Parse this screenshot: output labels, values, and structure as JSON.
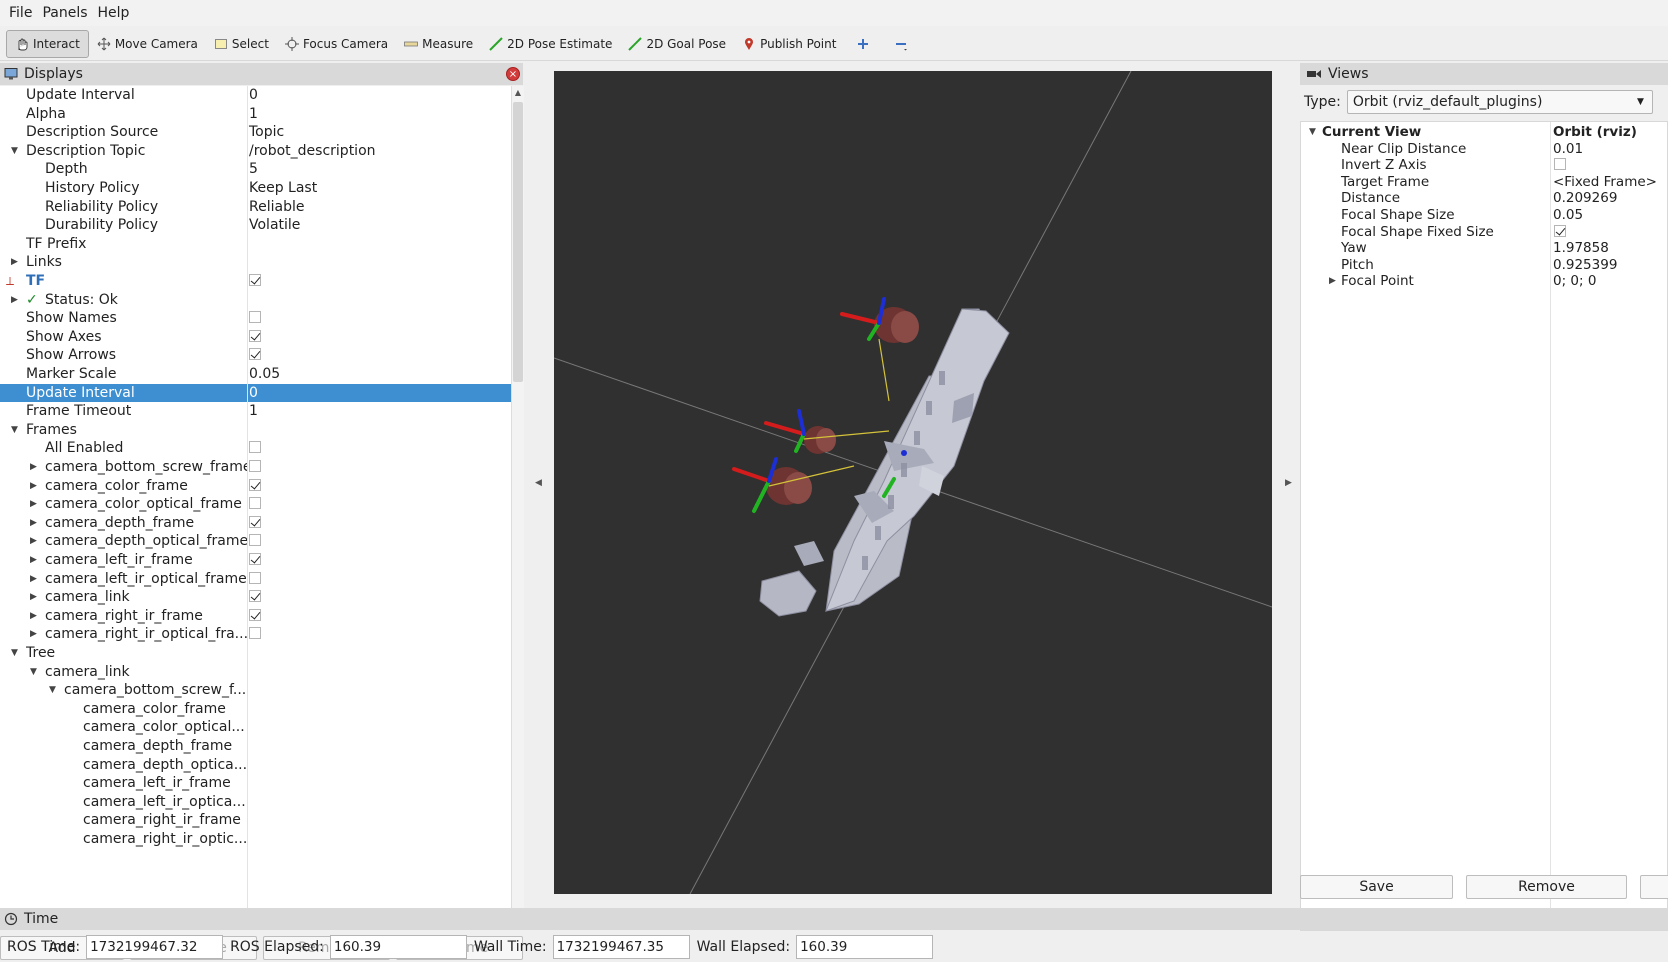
{
  "menu": [
    "File",
    "Panels",
    "Help"
  ],
  "toolbar": [
    {
      "label": "Interact",
      "icon": "interact-icon",
      "active": true
    },
    {
      "label": "Move Camera",
      "icon": "move-camera-icon"
    },
    {
      "label": "Select",
      "icon": "select-icon"
    },
    {
      "label": "Focus Camera",
      "icon": "focus-camera-icon"
    },
    {
      "label": "Measure",
      "icon": "measure-icon"
    },
    {
      "label": "2D Pose Estimate",
      "icon": "pose-estimate-icon"
    },
    {
      "label": "2D Goal Pose",
      "icon": "goal-pose-icon"
    },
    {
      "label": "Publish Point",
      "icon": "publish-point-icon"
    }
  ],
  "displays": {
    "title": "Displays",
    "rows": [
      {
        "name": "Update Interval",
        "value": "0",
        "indent": 0
      },
      {
        "name": "Alpha",
        "value": "1",
        "indent": 0
      },
      {
        "name": "Description Source",
        "value": "Topic",
        "indent": 0
      },
      {
        "name": "Description Topic",
        "value": "/robot_description",
        "indent": 0,
        "arrow": "down"
      },
      {
        "name": "Depth",
        "value": "5",
        "indent": 1
      },
      {
        "name": "History Policy",
        "value": "Keep Last",
        "indent": 1
      },
      {
        "name": "Reliability Policy",
        "value": "Reliable",
        "indent": 1
      },
      {
        "name": "Durability Policy",
        "value": "Volatile",
        "indent": 1
      },
      {
        "name": "TF Prefix",
        "value": "",
        "indent": 0
      },
      {
        "name": "Links",
        "value": "",
        "indent": 0,
        "arrow": "right"
      },
      {
        "name": "TF",
        "value": "",
        "indent": 0,
        "check": true,
        "tf": true
      },
      {
        "name": "Status: Ok",
        "value": "",
        "indent": 0,
        "arrow": "right",
        "status": true
      },
      {
        "name": "Show Names",
        "value": "",
        "indent": 0,
        "check": false
      },
      {
        "name": "Show Axes",
        "value": "",
        "indent": 0,
        "check": true
      },
      {
        "name": "Show Arrows",
        "value": "",
        "indent": 0,
        "check": true
      },
      {
        "name": "Marker Scale",
        "value": "0.05",
        "indent": 0
      },
      {
        "name": "Update Interval",
        "value": "0",
        "indent": 0,
        "selected": true
      },
      {
        "name": "Frame Timeout",
        "value": "1",
        "indent": 0
      },
      {
        "name": "Frames",
        "value": "",
        "indent": 0,
        "arrow": "down"
      },
      {
        "name": "All Enabled",
        "value": "",
        "indent": 1,
        "check": false
      },
      {
        "name": "camera_bottom_screw_frame",
        "value": "",
        "indent": 1,
        "arrow": "right",
        "check": false
      },
      {
        "name": "camera_color_frame",
        "value": "",
        "indent": 1,
        "arrow": "right",
        "check": true
      },
      {
        "name": "camera_color_optical_frame",
        "value": "",
        "indent": 1,
        "arrow": "right",
        "check": false
      },
      {
        "name": "camera_depth_frame",
        "value": "",
        "indent": 1,
        "arrow": "right",
        "check": true
      },
      {
        "name": "camera_depth_optical_frame",
        "value": "",
        "indent": 1,
        "arrow": "right",
        "check": false
      },
      {
        "name": "camera_left_ir_frame",
        "value": "",
        "indent": 1,
        "arrow": "right",
        "check": true
      },
      {
        "name": "camera_left_ir_optical_frame",
        "value": "",
        "indent": 1,
        "arrow": "right",
        "check": false
      },
      {
        "name": "camera_link",
        "value": "",
        "indent": 1,
        "arrow": "right",
        "check": true
      },
      {
        "name": "camera_right_ir_frame",
        "value": "",
        "indent": 1,
        "arrow": "right",
        "check": true
      },
      {
        "name": "camera_right_ir_optical_fra...",
        "value": "",
        "indent": 1,
        "arrow": "right",
        "check": false
      },
      {
        "name": "Tree",
        "value": "",
        "indent": 0,
        "arrow": "down"
      },
      {
        "name": "camera_link",
        "value": "",
        "indent": 1,
        "arrow": "down"
      },
      {
        "name": "camera_bottom_screw_f...",
        "value": "",
        "indent": 2,
        "arrow": "down"
      },
      {
        "name": "camera_color_frame",
        "value": "",
        "indent": 3
      },
      {
        "name": "camera_color_optical...",
        "value": "",
        "indent": 3
      },
      {
        "name": "camera_depth_frame",
        "value": "",
        "indent": 3
      },
      {
        "name": "camera_depth_optica...",
        "value": "",
        "indent": 3
      },
      {
        "name": "camera_left_ir_frame",
        "value": "",
        "indent": 3
      },
      {
        "name": "camera_left_ir_optica...",
        "value": "",
        "indent": 3
      },
      {
        "name": "camera_right_ir_frame",
        "value": "",
        "indent": 3
      },
      {
        "name": "camera_right_ir_optic...",
        "value": "",
        "indent": 3
      }
    ],
    "buttons": {
      "add": "Add",
      "duplicate": "Duplicate",
      "remove": "Remove",
      "rename": "Rename"
    }
  },
  "views": {
    "title": "Views",
    "type_label": "Type:",
    "type_value": "Orbit (rviz_default_plugins)",
    "rows": [
      {
        "name": "Current View",
        "value": "Orbit (rviz)",
        "header": true,
        "arrow": "down"
      },
      {
        "name": "Near Clip Distance",
        "value": "0.01"
      },
      {
        "name": "Invert Z Axis",
        "value": "",
        "check": false
      },
      {
        "name": "Target Frame",
        "value": "<Fixed Frame>"
      },
      {
        "name": "Distance",
        "value": "0.209269"
      },
      {
        "name": "Focal Shape Size",
        "value": "0.05"
      },
      {
        "name": "Focal Shape Fixed Size",
        "value": "",
        "check": true
      },
      {
        "name": "Yaw",
        "value": "1.97858"
      },
      {
        "name": "Pitch",
        "value": "0.925399"
      },
      {
        "name": "Focal Point",
        "value": "0; 0; 0",
        "arrow": "right"
      }
    ],
    "buttons": {
      "save": "Save",
      "remove": "Remove"
    }
  },
  "time": {
    "title": "Time",
    "ros_time_label": "ROS Time:",
    "ros_time": "1732199467.32",
    "ros_elapsed_label": "ROS Elapsed:",
    "ros_elapsed": "160.39",
    "wall_time_label": "Wall Time:",
    "wall_time": "1732199467.35",
    "wall_elapsed_label": "Wall Elapsed:",
    "wall_elapsed": "160.39"
  },
  "colors": {
    "selection": "#3d8fd1",
    "viewport_bg": "#303030",
    "panel_header": "#d9d9d9"
  }
}
